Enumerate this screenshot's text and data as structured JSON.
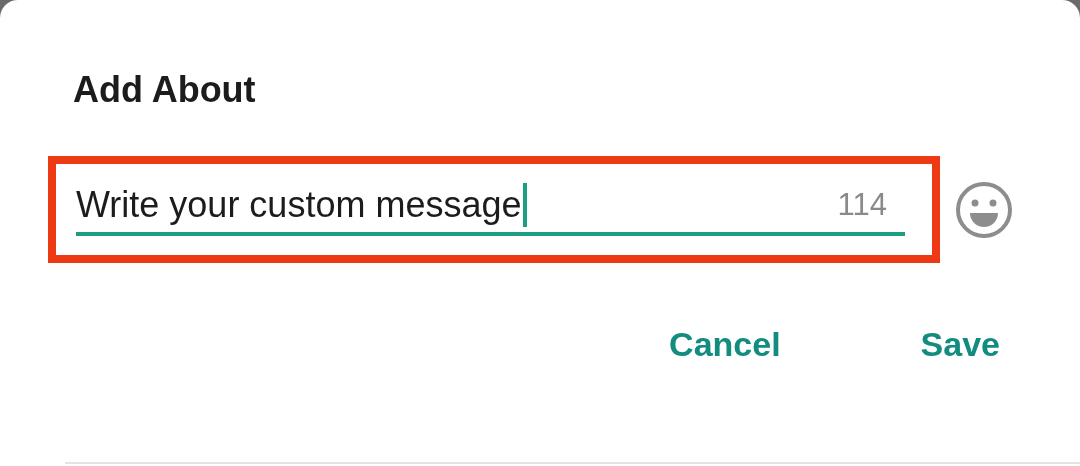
{
  "dialog": {
    "title": "Add About",
    "field": {
      "value": "Write your custom message",
      "counter": "114",
      "focused": true,
      "highlighted": true
    },
    "buttons": [
      {
        "label": "Cancel"
      },
      {
        "label": "Save"
      }
    ]
  }
}
